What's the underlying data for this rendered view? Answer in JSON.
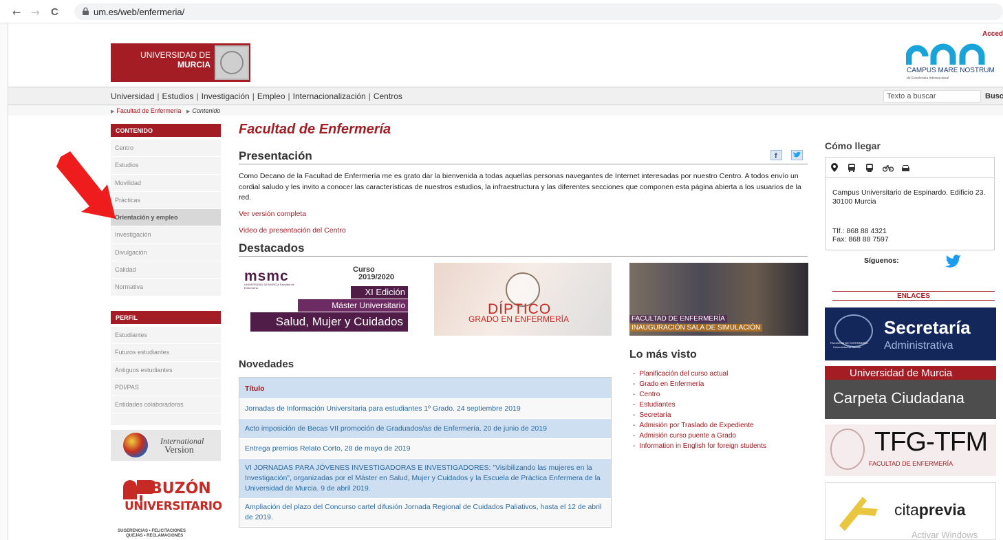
{
  "browser": {
    "back": "←",
    "forward": "→",
    "reload": "C",
    "url": "um.es/web/enfermeria/"
  },
  "header": {
    "accede": "Accede",
    "um_logo_line1": "UNIVERSIDAD DE",
    "um_logo_line2": "MURCIA",
    "cmn_name": "CAMPUS MARE NOSTRUM",
    "cmn_sub": "de Excelencia Internacional",
    "cmn_color": "#1aa3d8"
  },
  "topnav": {
    "links": [
      "Universidad",
      "Estudios",
      "Investigación",
      "Empleo",
      "Internacionalización",
      "Centros"
    ],
    "separator": "|",
    "search_placeholder": "Texto a buscar",
    "search_button": "Buscar"
  },
  "breadcrumb": {
    "items": [
      "Facultad de Enfermería",
      "Contenido"
    ]
  },
  "sidebar": {
    "contenido_header": "CONTENIDO",
    "contenido_items": [
      "Centro",
      "Estudios",
      "Movilidad",
      "Prácticas",
      "Orientación y empleo",
      "Investigación",
      "Divulgación",
      "Calidad",
      "Normativa"
    ],
    "active_item": "Orientación y empleo",
    "perfil_header": "PERFIL",
    "perfil_items": [
      "Estudiantes",
      "Futuros estudiantes",
      "Antiguos estudiantes",
      "PDI/PAS",
      "Entidades colaboradoras"
    ],
    "intl_line1": "International",
    "intl_line2": "Version",
    "buzon_line1": "BUZÓN",
    "buzon_line2": "UNIVERSITARIO",
    "buzon_small1": "SUGERENCIAS • FELICITACIONES",
    "buzon_small2": "QUEJAS • RECLAMACIONES"
  },
  "main": {
    "page_title": "Facultad de Enfermería",
    "presentacion_title": "Presentación",
    "intro": "Como Decano de la Facultad de Enfermería me es grato dar la bienvenida a todas aquellas personas navegantes de Internet interesadas por nuestro Centro. A todos envío un cordial saludo y les invito a conocer las características de nuestros estudios, la infraestructura y las diferentes secciones que componen esta página abierta a los usuarios de la red.",
    "link_full": "Ver versión completa",
    "link_video": "Video de presentación del Centro",
    "destacados_title": "Destacados",
    "feat1": {
      "logo": "msmc",
      "logo_sub": "UNIVERSIDAD DE MURCIA Facultad de Enfermería",
      "curso": "Curso",
      "year": "2019/2020",
      "edition": "XI Edición",
      "master": "Máster Universitario",
      "name": "Salud, Mujer y Cuidados"
    },
    "feat2": {
      "title": "DÍPTICO",
      "sub": "GRADO EN ENFERMERÍA"
    },
    "feat3": {
      "line1": "FACULTAD DE ENFERMERÍA",
      "line2": "INAUGURACIÓN SALA DE SIMULACIÓN"
    },
    "novedades_title": "Novedades",
    "news_header": "Título",
    "news": [
      "Jornadas de Información Universitaria para estudiantes 1º Grado. 24 septiembre 2019",
      "Acto imposición de Becas VII promoción de Graduados/as de Enfermería. 20 de junio de 2019",
      "Entrega premios Relato Corto, 28 de mayo de 2019",
      "VI JORNADAS PARA JÓVENES INVESTIGADORAS E INVESTIGADORES: \"Visibilizando las mujeres en la Investigación\", organizadas por el Máster en Salud, Mujer y Cuidados y la Escuela de Práctica Enfermera de la Universidad de Murcia. 9 de abril 2019.",
      "Ampliación del plazo del Concurso cartel difusión Jornada Regional de Cuidados Paliativos, hasta el 12 de abril de 2019."
    ],
    "mostviewed_title": "Lo más visto",
    "mostviewed": [
      "Planificación del curso actual",
      "Grado en Enfermería",
      "Centro",
      "Estudiantes",
      "Secretaría",
      "Admisión por Traslado de Expediente",
      "Admisión curso puente a Grado",
      "Information in English for foreign students"
    ]
  },
  "right": {
    "how_title": "Cómo llegar",
    "tabs": [
      "location-icon",
      "bus-icon",
      "tram-icon",
      "bicycle-icon",
      "car-icon"
    ],
    "address1": "Campus Universitario de Espinardo. Edificio 23.",
    "address2": "30100 Murcia",
    "tel": "Tlf.: 868 88 4321",
    "fax": "Fax: 868 88 7597",
    "siguenos": "Síguenos:",
    "links_header": "ENLACES",
    "sec_title": "Secretaría",
    "sec_sub": "Administrativa",
    "sec_cap1": "FACULTAD DE ENFERMERÍA",
    "sec_cap2": "Universidad de Murcia",
    "carp_top": "Universidad de Murcia",
    "carp_main": "Carpeta Ciudadana",
    "tfg_main": "TFG-TFM",
    "tfg_sub": "FACULTAD DE ENFERMERÍA",
    "cita1": "cita",
    "cita2": "previa",
    "watermark": "Activar Windows"
  },
  "colors": {
    "brand_red": "#a51d24",
    "msmc_purple": "#4f1d48",
    "news_blue": "#cddff0"
  }
}
